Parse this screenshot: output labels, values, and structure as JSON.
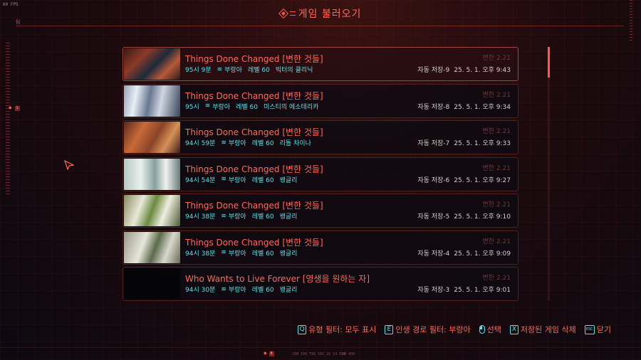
{
  "hud": {
    "fps": "60 FPS",
    "top_tag": "팀",
    "left_marker": "1",
    "bottom_marker": "8",
    "bottom_coords": "JIN 100 TAS 101 2X 14 659",
    "bottom_code": "20 450"
  },
  "header": {
    "title": "게임 불러오기"
  },
  "saves": [
    {
      "title": "Things Done Changed [변한 것들]",
      "version": "변한 2.21",
      "playtime": "95시 9분",
      "lifepath": "부랑아",
      "level": "레벨 60",
      "location": "빅터의 클리닉",
      "slot": "자동 저장-9",
      "datetime": "25. 5. 1. 오후 9:43"
    },
    {
      "title": "Things Done Changed [변한 것들]",
      "version": "변한 2.21",
      "playtime": "95시",
      "lifepath": "부랑아",
      "level": "레벨 60",
      "location": "미스티의 에소테리카",
      "slot": "자동 저장-8",
      "datetime": "25. 5. 1. 오후 9:34"
    },
    {
      "title": "Things Done Changed [변한 것들]",
      "version": "변한 2.21",
      "playtime": "94시 59분",
      "lifepath": "부랑아",
      "level": "레벨 60",
      "location": "리틀 차이나",
      "slot": "자동 저장-7",
      "datetime": "25. 5. 1. 오후 9:33"
    },
    {
      "title": "Things Done Changed [변한 것들]",
      "version": "변한 2.21",
      "playtime": "94시 54분",
      "lifepath": "부랑아",
      "level": "레벨 60",
      "location": "왱글리",
      "slot": "자동 저장-6",
      "datetime": "25. 5. 1. 오후 9:27"
    },
    {
      "title": "Things Done Changed [변한 것들]",
      "version": "변한 2.21",
      "playtime": "94시 38분",
      "lifepath": "부랑아",
      "level": "레벨 60",
      "location": "왱글리",
      "slot": "자동 저장-5",
      "datetime": "25. 5. 1. 오후 9:10"
    },
    {
      "title": "Things Done Changed [변한 것들]",
      "version": "변한 2.21",
      "playtime": "94시 38분",
      "lifepath": "부랑아",
      "level": "레벨 60",
      "location": "왱글리",
      "slot": "자동 저장-4",
      "datetime": "25. 5. 1. 오후 9:09"
    },
    {
      "title": "Who Wants to Live Forever [영생을 원하는 자]",
      "version": "변한 2.21",
      "playtime": "94시 30분",
      "lifepath": "부랑아",
      "level": "레벨 60",
      "location": "왱글리",
      "slot": "자동 저장-3",
      "datetime": "25. 5. 1. 오후 9:01"
    }
  ],
  "footer": {
    "type_filter_key": "Q",
    "type_filter": "유형 필터: 모두 표시",
    "lifepath_filter_key": "E",
    "lifepath_filter": "인생 경로 필터: 부랑아",
    "select": "선택",
    "delete_key": "X",
    "delete": "저장된 게임 삭제",
    "close_key": "ESC",
    "close": "닫기"
  },
  "colors": {
    "accent": "#ff5a50",
    "cyan": "#5fe0e8",
    "background": "#1c0a0d"
  },
  "scroll": {
    "position": 0.0,
    "visible_fraction": 0.12
  }
}
